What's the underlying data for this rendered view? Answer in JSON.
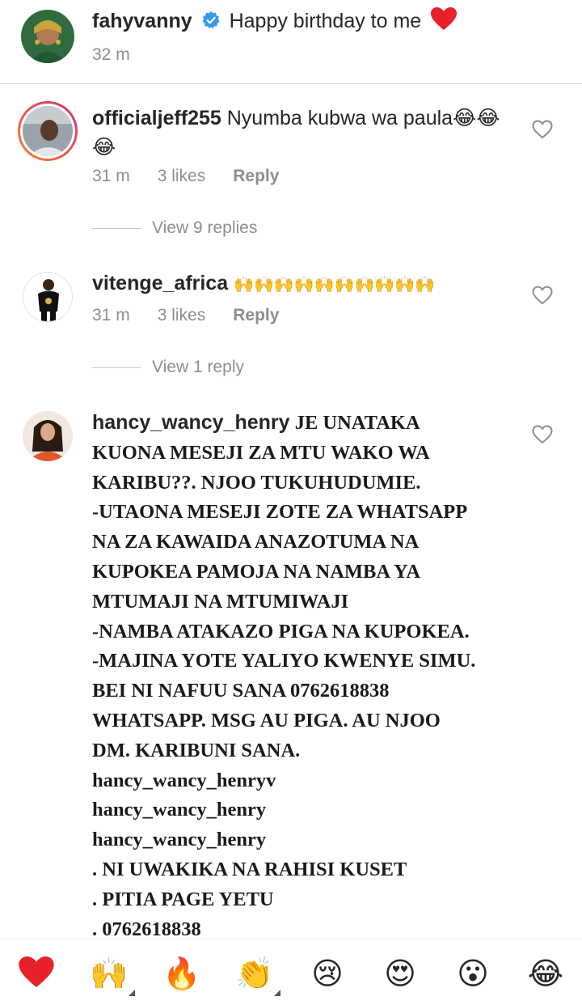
{
  "caption": {
    "username": "fahyvanny",
    "verified": true,
    "text": "Happy birthday to me",
    "emoji": "red-heart",
    "time": "32 m"
  },
  "comments": [
    {
      "username": "officialjeff255",
      "text": "Nyumba kubwa wa paula",
      "emojis": "😂😂😂",
      "time": "31 m",
      "likes": "3 likes",
      "reply": "Reply",
      "view_replies": "View 9 replies",
      "has_story_ring": true
    },
    {
      "username": "vitenge_africa",
      "text": "🙌🙌🙌🙌🙌🙌🙌🙌🙌🙌",
      "time": "31 m",
      "likes": "3 likes",
      "reply": "Reply",
      "view_replies": "View 1 reply"
    },
    {
      "username": "hancy_wancy_henry",
      "lines": [
        "JE UNATAKA",
        "KUONA MESEJI ZA MTU WAKO WA",
        "KARIBU??. NJOO TUKUHUDUMIE.",
        "-UTAONA MESEJI ZOTE ZA WHATSAPP",
        "NA ZA KAWAIDA ANAZOTUMA NA",
        "KUPOKEA PAMOJA NA NAMBA YA",
        "MTUMAJI NA MTUMIWAJI",
        "-NAMBA ATAKAZO PIGA NA KUPOKEA.",
        "-MAJINA YOTE YALIYO KWENYE SIMU.",
        "BEI NI NAFUU SANA 0762618838",
        "WHATSAPP. MSG AU PIGA. AU NJOO",
        "DM. KARIBUNI SANA.",
        "hancy_wancy_henryv",
        "hancy_wancy_henry",
        "hancy_wancy_henry",
        ". NI UWAKIKA NA RAHISI KUSET",
        ". PITIA PAGE YETU",
        ". 0762618838"
      ]
    }
  ],
  "reactions": [
    {
      "name": "heart",
      "glyph": "❤",
      "has_more": false
    },
    {
      "name": "raising-hands",
      "glyph": "🙌",
      "has_more": true
    },
    {
      "name": "fire",
      "glyph": "🔥",
      "has_more": false
    },
    {
      "name": "clapping-hands",
      "glyph": "👏",
      "has_more": true
    },
    {
      "name": "crying-face",
      "glyph": "😢",
      "has_more": false
    },
    {
      "name": "heart-eyes",
      "glyph": "😍",
      "has_more": false
    },
    {
      "name": "surprised-face",
      "glyph": "😮",
      "has_more": false
    },
    {
      "name": "tears-of-joy",
      "glyph": "😂",
      "has_more": false
    }
  ],
  "colors": {
    "verified": "#3897f0",
    "heart": "#ed4956",
    "story_ring_start": "#f58529",
    "story_ring_end": "#dd2a7b"
  }
}
